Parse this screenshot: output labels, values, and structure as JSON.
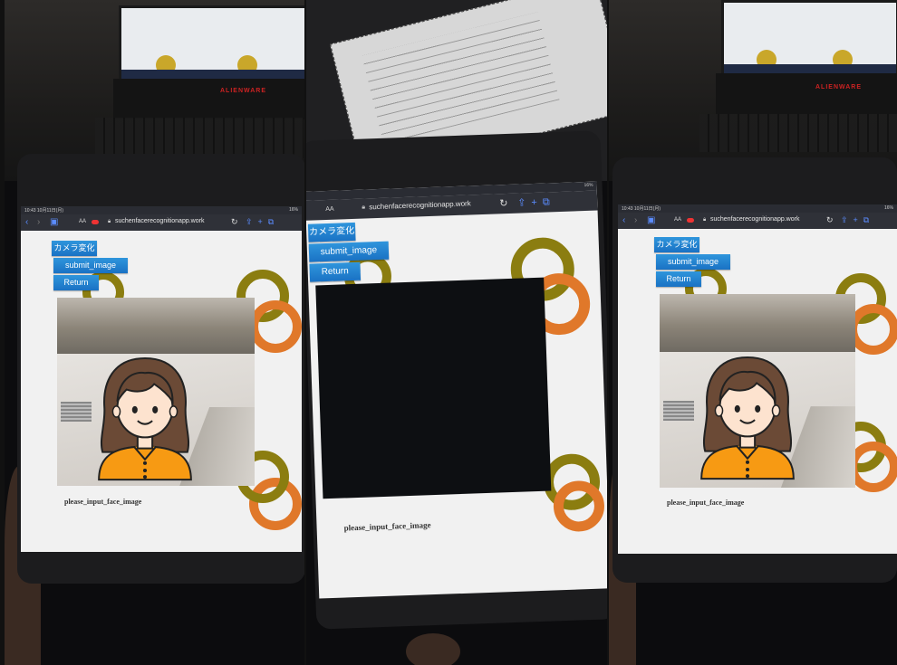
{
  "status_bar": {
    "time": "10:43 10月11日(月)",
    "battery": "16%"
  },
  "browser": {
    "aa_label": "AA",
    "url": "suchenfacerecognitionapp.work"
  },
  "buttons": {
    "camera_switch": "カメラ変化",
    "submit_image": "submit_image",
    "return": "Return"
  },
  "caption": "please_input_face_image",
  "icons": [
    "back-icon",
    "forward-icon",
    "sidebar-icon",
    "lock-icon",
    "reload-icon",
    "share-icon",
    "new-tab-icon",
    "tabs-icon",
    "record-icon",
    "face-avatar-icon"
  ],
  "colors": {
    "button_blue": "#2384d3",
    "ring_olive": "#9b8a10",
    "ring_orange": "#e0782a",
    "ring_blue": "#2f7fd0"
  }
}
